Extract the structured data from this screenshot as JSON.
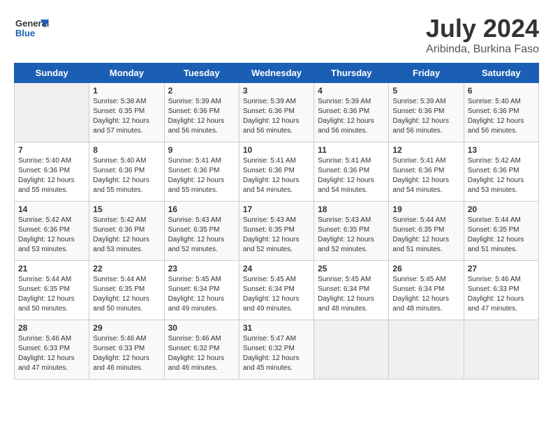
{
  "header": {
    "logo_general": "General",
    "logo_blue": "Blue",
    "month_year": "July 2024",
    "location": "Aribinda, Burkina Faso"
  },
  "days_of_week": [
    "Sunday",
    "Monday",
    "Tuesday",
    "Wednesday",
    "Thursday",
    "Friday",
    "Saturday"
  ],
  "weeks": [
    [
      {
        "day": "",
        "sunrise": "",
        "sunset": "",
        "daylight": "",
        "empty": true
      },
      {
        "day": "1",
        "sunrise": "Sunrise: 5:38 AM",
        "sunset": "Sunset: 6:35 PM",
        "daylight": "Daylight: 12 hours and 57 minutes."
      },
      {
        "day": "2",
        "sunrise": "Sunrise: 5:39 AM",
        "sunset": "Sunset: 6:36 PM",
        "daylight": "Daylight: 12 hours and 56 minutes."
      },
      {
        "day": "3",
        "sunrise": "Sunrise: 5:39 AM",
        "sunset": "Sunset: 6:36 PM",
        "daylight": "Daylight: 12 hours and 56 minutes."
      },
      {
        "day": "4",
        "sunrise": "Sunrise: 5:39 AM",
        "sunset": "Sunset: 6:36 PM",
        "daylight": "Daylight: 12 hours and 56 minutes."
      },
      {
        "day": "5",
        "sunrise": "Sunrise: 5:39 AM",
        "sunset": "Sunset: 6:36 PM",
        "daylight": "Daylight: 12 hours and 56 minutes."
      },
      {
        "day": "6",
        "sunrise": "Sunrise: 5:40 AM",
        "sunset": "Sunset: 6:36 PM",
        "daylight": "Daylight: 12 hours and 56 minutes."
      }
    ],
    [
      {
        "day": "7",
        "sunrise": "Sunrise: 5:40 AM",
        "sunset": "Sunset: 6:36 PM",
        "daylight": "Daylight: 12 hours and 55 minutes."
      },
      {
        "day": "8",
        "sunrise": "Sunrise: 5:40 AM",
        "sunset": "Sunset: 6:36 PM",
        "daylight": "Daylight: 12 hours and 55 minutes."
      },
      {
        "day": "9",
        "sunrise": "Sunrise: 5:41 AM",
        "sunset": "Sunset: 6:36 PM",
        "daylight": "Daylight: 12 hours and 55 minutes."
      },
      {
        "day": "10",
        "sunrise": "Sunrise: 5:41 AM",
        "sunset": "Sunset: 6:36 PM",
        "daylight": "Daylight: 12 hours and 54 minutes."
      },
      {
        "day": "11",
        "sunrise": "Sunrise: 5:41 AM",
        "sunset": "Sunset: 6:36 PM",
        "daylight": "Daylight: 12 hours and 54 minutes."
      },
      {
        "day": "12",
        "sunrise": "Sunrise: 5:41 AM",
        "sunset": "Sunset: 6:36 PM",
        "daylight": "Daylight: 12 hours and 54 minutes."
      },
      {
        "day": "13",
        "sunrise": "Sunrise: 5:42 AM",
        "sunset": "Sunset: 6:36 PM",
        "daylight": "Daylight: 12 hours and 53 minutes."
      }
    ],
    [
      {
        "day": "14",
        "sunrise": "Sunrise: 5:42 AM",
        "sunset": "Sunset: 6:36 PM",
        "daylight": "Daylight: 12 hours and 53 minutes."
      },
      {
        "day": "15",
        "sunrise": "Sunrise: 5:42 AM",
        "sunset": "Sunset: 6:36 PM",
        "daylight": "Daylight: 12 hours and 53 minutes."
      },
      {
        "day": "16",
        "sunrise": "Sunrise: 5:43 AM",
        "sunset": "Sunset: 6:35 PM",
        "daylight": "Daylight: 12 hours and 52 minutes."
      },
      {
        "day": "17",
        "sunrise": "Sunrise: 5:43 AM",
        "sunset": "Sunset: 6:35 PM",
        "daylight": "Daylight: 12 hours and 52 minutes."
      },
      {
        "day": "18",
        "sunrise": "Sunrise: 5:43 AM",
        "sunset": "Sunset: 6:35 PM",
        "daylight": "Daylight: 12 hours and 52 minutes."
      },
      {
        "day": "19",
        "sunrise": "Sunrise: 5:44 AM",
        "sunset": "Sunset: 6:35 PM",
        "daylight": "Daylight: 12 hours and 51 minutes."
      },
      {
        "day": "20",
        "sunrise": "Sunrise: 5:44 AM",
        "sunset": "Sunset: 6:35 PM",
        "daylight": "Daylight: 12 hours and 51 minutes."
      }
    ],
    [
      {
        "day": "21",
        "sunrise": "Sunrise: 5:44 AM",
        "sunset": "Sunset: 6:35 PM",
        "daylight": "Daylight: 12 hours and 50 minutes."
      },
      {
        "day": "22",
        "sunrise": "Sunrise: 5:44 AM",
        "sunset": "Sunset: 6:35 PM",
        "daylight": "Daylight: 12 hours and 50 minutes."
      },
      {
        "day": "23",
        "sunrise": "Sunrise: 5:45 AM",
        "sunset": "Sunset: 6:34 PM",
        "daylight": "Daylight: 12 hours and 49 minutes."
      },
      {
        "day": "24",
        "sunrise": "Sunrise: 5:45 AM",
        "sunset": "Sunset: 6:34 PM",
        "daylight": "Daylight: 12 hours and 49 minutes."
      },
      {
        "day": "25",
        "sunrise": "Sunrise: 5:45 AM",
        "sunset": "Sunset: 6:34 PM",
        "daylight": "Daylight: 12 hours and 48 minutes."
      },
      {
        "day": "26",
        "sunrise": "Sunrise: 5:45 AM",
        "sunset": "Sunset: 6:34 PM",
        "daylight": "Daylight: 12 hours and 48 minutes."
      },
      {
        "day": "27",
        "sunrise": "Sunrise: 5:46 AM",
        "sunset": "Sunset: 6:33 PM",
        "daylight": "Daylight: 12 hours and 47 minutes."
      }
    ],
    [
      {
        "day": "28",
        "sunrise": "Sunrise: 5:46 AM",
        "sunset": "Sunset: 6:33 PM",
        "daylight": "Daylight: 12 hours and 47 minutes."
      },
      {
        "day": "29",
        "sunrise": "Sunrise: 5:46 AM",
        "sunset": "Sunset: 6:33 PM",
        "daylight": "Daylight: 12 hours and 46 minutes."
      },
      {
        "day": "30",
        "sunrise": "Sunrise: 5:46 AM",
        "sunset": "Sunset: 6:32 PM",
        "daylight": "Daylight: 12 hours and 46 minutes."
      },
      {
        "day": "31",
        "sunrise": "Sunrise: 5:47 AM",
        "sunset": "Sunset: 6:32 PM",
        "daylight": "Daylight: 12 hours and 45 minutes."
      },
      {
        "day": "",
        "sunrise": "",
        "sunset": "",
        "daylight": "",
        "empty": true
      },
      {
        "day": "",
        "sunrise": "",
        "sunset": "",
        "daylight": "",
        "empty": true
      },
      {
        "day": "",
        "sunrise": "",
        "sunset": "",
        "daylight": "",
        "empty": true
      }
    ]
  ]
}
